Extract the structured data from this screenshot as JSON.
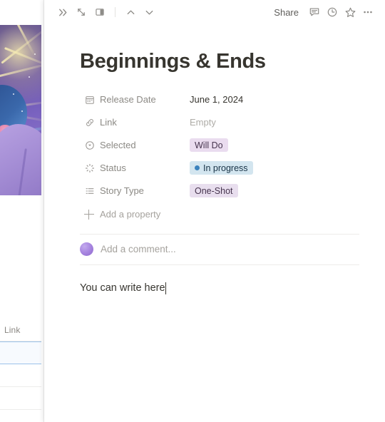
{
  "background": {
    "cover_image_alt": "anime-character-artwork",
    "table": {
      "column_header": "Link",
      "rows": [
        "",
        "",
        ""
      ]
    }
  },
  "toolbar": {
    "left_actions": [
      {
        "name": "expand-sidebar-icon",
        "label": "≫"
      },
      {
        "name": "open-full-page-icon",
        "label": "open full page"
      },
      {
        "name": "side-peek-icon",
        "label": "side peek"
      }
    ],
    "nav": {
      "up_label": "previous page",
      "down_label": "next page"
    },
    "share_label": "Share",
    "right_actions": [
      {
        "name": "comment-icon",
        "label": "Comments"
      },
      {
        "name": "history-icon",
        "label": "Updates"
      },
      {
        "name": "favorite-star-icon",
        "label": "Favorite"
      },
      {
        "name": "more-options-icon",
        "label": "More"
      }
    ]
  },
  "page": {
    "title": "Beginnings & Ends",
    "body_text": "You can write here"
  },
  "properties": [
    {
      "icon": "calendar-icon",
      "label": "Release Date",
      "value": "June 1, 2024",
      "type": "date",
      "empty": false
    },
    {
      "icon": "link-icon",
      "label": "Link",
      "value": "Empty",
      "type": "url",
      "empty": true
    },
    {
      "icon": "select-circle-icon",
      "label": "Selected",
      "value": "Will Do",
      "type": "select",
      "empty": false,
      "pill_bg": "#eadcef",
      "pill_fg": "#46344e"
    },
    {
      "icon": "status-spinner-icon",
      "label": "Status",
      "value": "In progress",
      "type": "status",
      "empty": false,
      "pill_bg": "#d3e5ef",
      "pill_fg": "#183347",
      "dot_color": "#3b82bd"
    },
    {
      "icon": "multi-select-list-icon",
      "label": "Story Type",
      "value": "One-Shot",
      "type": "multi_select",
      "empty": false,
      "pill_bg": "#e8deee",
      "pill_fg": "#46344e"
    }
  ],
  "add_property_label": "Add a property",
  "comment": {
    "placeholder": "Add a comment...",
    "avatar_alt": "user-avatar"
  },
  "colors": {
    "text_primary": "#37352f",
    "text_muted": "#8c8a85",
    "text_placeholder": "#a5a29d",
    "divider": "#edecea",
    "row_selected_bg": "#f7fafe",
    "row_selected_border": "#9cc2ea"
  }
}
